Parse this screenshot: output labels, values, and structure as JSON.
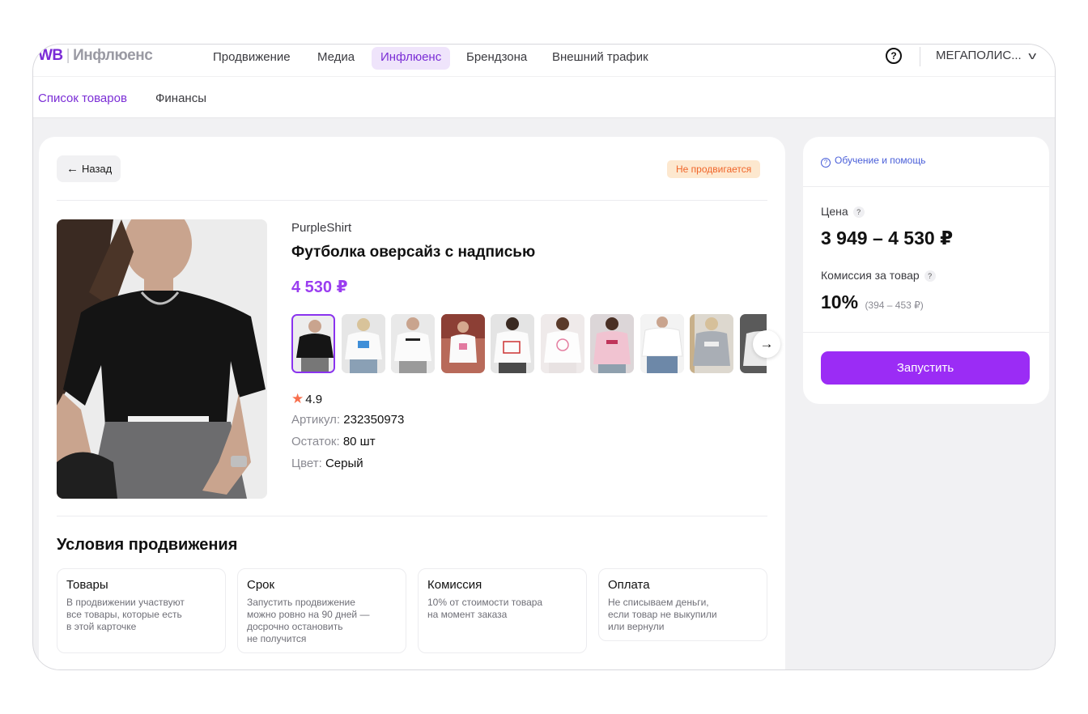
{
  "header": {
    "logo_wb": "WB",
    "logo_product": "Инфлюенс",
    "nav": [
      {
        "label": "Продвижение"
      },
      {
        "label": "Медиа"
      },
      {
        "label": "Инфлюенс"
      },
      {
        "label": "Брендзона"
      },
      {
        "label": "Внешний трафик"
      }
    ],
    "help_icon_glyph": "?",
    "org_name": "МЕГАПОЛИС...",
    "chevron_glyph": "v"
  },
  "subnav": {
    "items": [
      {
        "label": "Список товаров"
      },
      {
        "label": "Финансы"
      }
    ]
  },
  "product": {
    "back_label": "Назад",
    "back_arrow": "←",
    "status_badge": "Не продвигается",
    "brand": "PurpleShirt",
    "title": "Футболка оверсайз с надписью",
    "price": "4 530 ₽",
    "rating_star": "★",
    "rating": "4.9",
    "article_label": "Артикул:",
    "article_value": "232350973",
    "stock_label": "Остаток:",
    "stock_value": "80 шт",
    "color_label": "Цвет:",
    "color_value": "Серый",
    "next_arrow": "→"
  },
  "conditions": {
    "title": "Условия продвижения",
    "cards": [
      {
        "title": "Товары",
        "text": "В продвижении участвуют\nвсе товары, которые есть\nв этой карточке"
      },
      {
        "title": "Срок",
        "text": "Запустить продвижение\nможно ровно на 90 дней —\nдосрочно остановить\nне получится"
      },
      {
        "title": "Комиссия",
        "text": "10% от стоимости товара\nна момент заказа"
      },
      {
        "title": "Оплата",
        "text": "Не списываем деньги,\nесли товар не выкупили\nили вернули"
      }
    ]
  },
  "side": {
    "help_icon_glyph": "?",
    "help_label": "Обучение и помощь",
    "price_label": "Цена",
    "tooltip_glyph": "?",
    "price_range": "3 949 – 4 530 ₽",
    "commission_label": "Комиссия за товар",
    "commission_value": "10%",
    "commission_range": "(394 – 453 ₽)",
    "launch_label": "Запустить"
  },
  "colors": {
    "accent": "#9b2cf5",
    "brand_purple": "#7b2ed6",
    "price_purple": "#9a3df0",
    "badge_bg": "#fde8cf",
    "badge_text": "#f0652a",
    "link_blue": "#4a5fd9",
    "star": "#f86f4d"
  }
}
